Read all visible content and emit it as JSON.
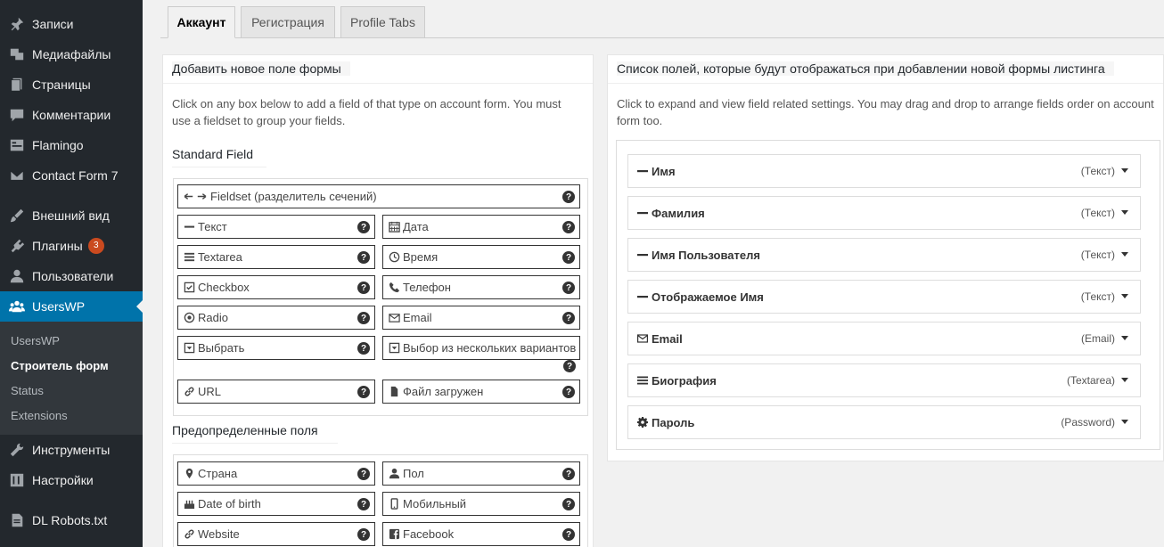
{
  "sidebar": {
    "items": [
      {
        "label": "Записи",
        "icon": "pin-icon"
      },
      {
        "label": "Медиафайлы",
        "icon": "media-icon"
      },
      {
        "label": "Страницы",
        "icon": "pages-icon"
      },
      {
        "label": "Комментарии",
        "icon": "comment-icon"
      },
      {
        "label": "Flamingo",
        "icon": "flamingo-icon"
      },
      {
        "label": "Contact Form 7",
        "icon": "mail-icon"
      },
      {
        "label": "Внешний вид",
        "icon": "brush-icon"
      },
      {
        "label": "Плагины",
        "icon": "plugin-icon",
        "badge": "3"
      },
      {
        "label": "Пользователи",
        "icon": "user-icon"
      },
      {
        "label": "UsersWP",
        "icon": "users-group-icon"
      },
      {
        "label": "Инструменты",
        "icon": "wrench-icon"
      },
      {
        "label": "Настройки",
        "icon": "settings-icon"
      },
      {
        "label": "DL Robots.txt",
        "icon": "document-icon"
      }
    ],
    "submenu": [
      "UsersWP",
      "Строитель форм",
      "Status",
      "Extensions"
    ]
  },
  "tabs": [
    "Аккаунт",
    "Регистрация",
    "Profile Tabs"
  ],
  "left_panel": {
    "title": "Добавить новое поле формы",
    "desc": "Click on any box below to add a field of that type on account form. You must use a fieldset to group your fields.",
    "standard_title": "Standard Field",
    "fieldset": "Fieldset (разделитель сечений)",
    "standard_fields": [
      {
        "label": "Текст",
        "icon": "minus-icon"
      },
      {
        "label": "Дата",
        "icon": "calendar-icon"
      },
      {
        "label": "Textarea",
        "icon": "lines-icon"
      },
      {
        "label": "Время",
        "icon": "clock-icon"
      },
      {
        "label": "Checkbox",
        "icon": "checkbox-icon"
      },
      {
        "label": "Телефон",
        "icon": "phone-icon"
      },
      {
        "label": "Radio",
        "icon": "radio-icon"
      },
      {
        "label": "Email",
        "icon": "envelope-icon"
      },
      {
        "label": "Выбрать",
        "icon": "select-icon"
      },
      {
        "label": "Выбор из нескольких вариантов",
        "icon": "select-icon"
      },
      {
        "label": "URL",
        "icon": "link-icon"
      },
      {
        "label": "Файл загружен",
        "icon": "file-icon"
      }
    ],
    "predefined_title": "Предопределенные поля",
    "predefined_fields": [
      {
        "label": "Страна",
        "icon": "map-marker-icon"
      },
      {
        "label": "Пол",
        "icon": "user-icon"
      },
      {
        "label": "Date of birth",
        "icon": "birthday-cake-icon"
      },
      {
        "label": "Мобильный",
        "icon": "mobile-icon"
      },
      {
        "label": "Website",
        "icon": "link-icon"
      },
      {
        "label": "Facebook",
        "icon": "facebook-icon"
      }
    ],
    "help_glyph": "?"
  },
  "right_panel": {
    "title": "Список полей, которые будут отображаться при добавлении новой формы листинга",
    "desc": "Click to expand and view field related settings. You may drag and drop to arrange fields order on account form too.",
    "fields": [
      {
        "label": "Имя",
        "type": "(Текст)",
        "icon": "minus-icon"
      },
      {
        "label": "Фамилия",
        "type": "(Текст)",
        "icon": "minus-icon"
      },
      {
        "label": "Имя Пользователя",
        "type": "(Текст)",
        "icon": "minus-icon"
      },
      {
        "label": "Отображаемое Имя",
        "type": "(Текст)",
        "icon": "minus-icon"
      },
      {
        "label": "Email",
        "type": "(Email)",
        "icon": "envelope-icon"
      },
      {
        "label": "Биография",
        "type": "(Textarea)",
        "icon": "lines-icon"
      },
      {
        "label": "Пароль",
        "type": "(Password)",
        "icon": "gear-icon"
      }
    ]
  }
}
